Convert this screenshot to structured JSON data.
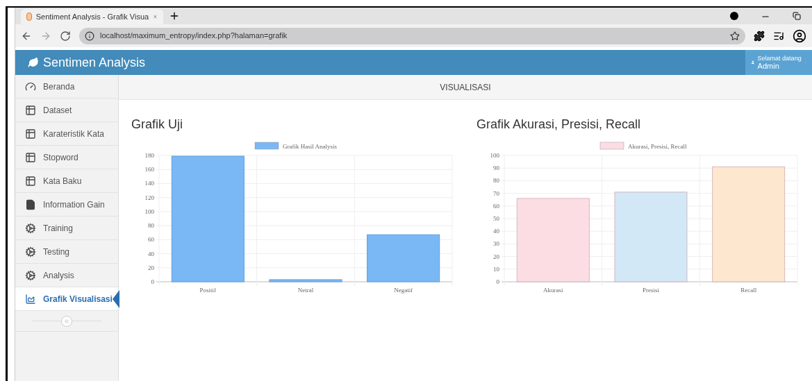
{
  "browser": {
    "tab_title": "Sentiment Analysis - Grafik Visua",
    "url": "localhost/maximum_entropy/index.php?halaman=grafik"
  },
  "header": {
    "brand": "Sentimen Analysis",
    "greeting": "Selamat datang",
    "user": "Admin"
  },
  "sidebar": {
    "items": [
      {
        "label": "Beranda",
        "kind": "home",
        "selected": false
      },
      {
        "label": "Dataset",
        "kind": "table",
        "selected": false
      },
      {
        "label": "Karateristik Kata",
        "kind": "table",
        "selected": false
      },
      {
        "label": "Stopword",
        "kind": "table",
        "selected": false
      },
      {
        "label": "Kata Baku",
        "kind": "table",
        "selected": false
      },
      {
        "label": "Information Gain",
        "kind": "file",
        "selected": false
      },
      {
        "label": "Training",
        "kind": "cogs",
        "selected": false
      },
      {
        "label": "Testing",
        "kind": "cogs",
        "selected": false
      },
      {
        "label": "Analysis",
        "kind": "cogs",
        "selected": false
      },
      {
        "label": "Grafik Visualisasi",
        "kind": "chart",
        "selected": true
      }
    ]
  },
  "page_title": "VISUALISASI",
  "charts": [
    {
      "title": "Grafik Uji",
      "chart_data": {
        "type": "bar",
        "categories": [
          "Positif",
          "Netral",
          "Negatif"
        ],
        "series": [
          {
            "name": "Grafik Hasil Analysis",
            "color": "#7ab8f5",
            "values": [
              179,
              3,
              67
            ]
          }
        ],
        "grid": true,
        "ylim": [
          0,
          180
        ],
        "yticks": [
          0,
          20,
          40,
          60,
          80,
          100,
          120,
          140,
          160,
          180
        ]
      }
    },
    {
      "title": "Grafik Akurasi, Presisi, Recall",
      "chart_data": {
        "type": "bar",
        "categories": [
          "Akurasi",
          "Presisi",
          "Recall"
        ],
        "series": [
          {
            "name": "Akurasi, Presisi, Recall",
            "color": "#fcdde4",
            "values": [
              66,
              null,
              null
            ]
          },
          {
            "color": "#d3e8f7",
            "values": [
              null,
              71,
              null
            ]
          },
          {
            "color": "#fde7cf",
            "values": [
              null,
              null,
              91
            ]
          }
        ],
        "stacked": true,
        "grid": true,
        "ylim": [
          0,
          100
        ],
        "yticks": [
          0,
          10,
          20,
          30,
          40,
          50,
          60,
          70,
          80,
          90,
          100
        ]
      }
    }
  ]
}
